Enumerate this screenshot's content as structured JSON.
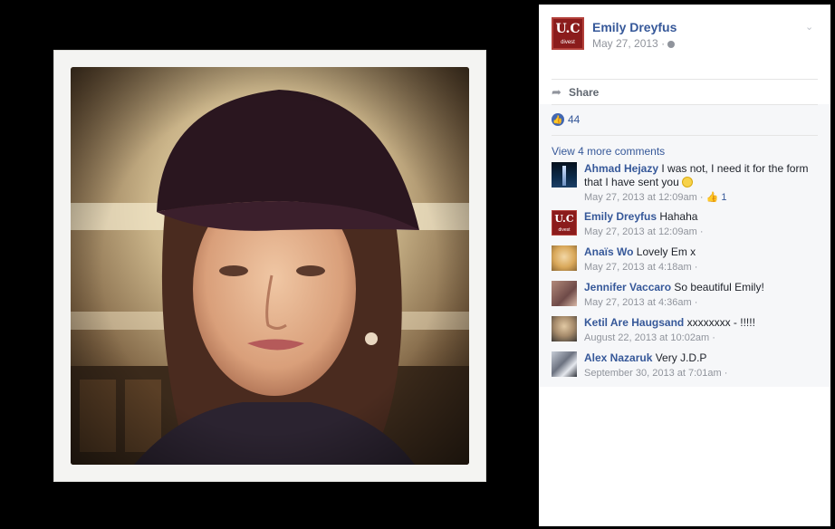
{
  "post": {
    "author": "Emily Dreyfus",
    "date": "May 27, 2013",
    "page_avatar": {
      "logo_top": "U.C",
      "logo_bottom": "divest"
    }
  },
  "actions": {
    "share_label": "Share"
  },
  "reactions": {
    "count": "44"
  },
  "comments_section": {
    "view_more_label": "View 4 more comments",
    "items": [
      {
        "name": "Ahmad Hejazy",
        "text": "I was not, I need it for the form that I have sent you",
        "time": "May 27, 2013 at 12:09am",
        "likes": "1"
      },
      {
        "name": "Emily Dreyfus",
        "text": "Hahaha",
        "time": "May 27, 2013 at 12:09am",
        "likes": ""
      },
      {
        "name": "Anaïs Wo",
        "text": "Lovely Em x",
        "time": "May 27, 2013 at 4:18am",
        "likes": ""
      },
      {
        "name": "Jennifer Vaccaro",
        "text": "So beautiful Emily!",
        "time": "May 27, 2013 at 4:36am",
        "likes": ""
      },
      {
        "name": "Ketil Are Haugsand",
        "text": "xxxxxxxx - !!!!!",
        "time": "August 22, 2013 at 10:02am",
        "likes": ""
      },
      {
        "name": "Alex Nazaruk",
        "text": "Very J.D.P",
        "time": "September 30, 2013 at 7:01am",
        "likes": ""
      }
    ]
  },
  "colors": {
    "link_blue": "#365899",
    "meta_gray": "#90949c",
    "like_blue": "#4267b2",
    "page_avatar_red": "#8b1c1c"
  }
}
